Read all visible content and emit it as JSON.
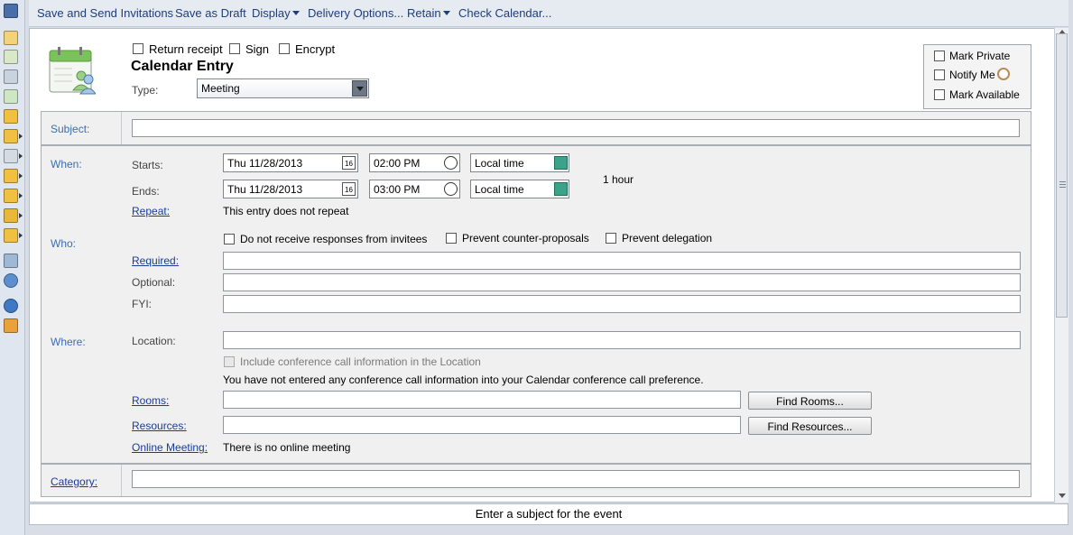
{
  "toolbar": {
    "send_label": "Save and Send Invitations",
    "draft_label": "Save as Draft",
    "display_label": "Display",
    "delivery_label": "Delivery Options...",
    "retain_label": "Retain",
    "check_label": "Check Calendar..."
  },
  "header": {
    "return_receipt": "Return receipt",
    "sign": "Sign",
    "encrypt": "Encrypt",
    "title": "Calendar Entry",
    "type_label": "Type:",
    "type_value": "Meeting"
  },
  "options": {
    "mark_private": "Mark Private",
    "notify_me": "Notify Me",
    "mark_available": "Mark Available"
  },
  "subject": {
    "label": "Subject:",
    "value": ""
  },
  "when": {
    "label": "When:",
    "starts_label": "Starts:",
    "start_date": "Thu 11/28/2013",
    "start_time": "02:00 PM",
    "start_zone": "Local time",
    "ends_label": "Ends:",
    "end_date": "Thu 11/28/2013",
    "end_time": "03:00 PM",
    "end_zone": "Local time",
    "duration": "1 hour",
    "calendar_badge": "16",
    "repeat_label": "Repeat:",
    "repeat_text": "This entry does not repeat"
  },
  "who": {
    "label": "Who:",
    "no_responses": "Do not receive responses from invitees",
    "prevent_counter": "Prevent counter-proposals",
    "prevent_delegation": "Prevent delegation",
    "required_label": "Required:",
    "optional_label": "Optional:",
    "fyi_label": "FYI:"
  },
  "where": {
    "label": "Where:",
    "location_label": "Location:",
    "conference_check": "Include conference call information in the Location",
    "conference_note": "You have not entered any conference call information into your Calendar conference call preference.",
    "rooms_label": "Rooms:",
    "find_rooms": "Find Rooms...",
    "resources_label": "Resources:",
    "find_resources": "Find Resources...",
    "online_label": "Online Meeting:",
    "online_text": "There is no online meeting"
  },
  "category": {
    "label": "Category:"
  },
  "status": {
    "text": "Enter a subject for the event"
  },
  "colors": {
    "link": "#1a3c96",
    "section_label": "#3d6cb0",
    "toolbar_text": "#1e3d7a"
  }
}
